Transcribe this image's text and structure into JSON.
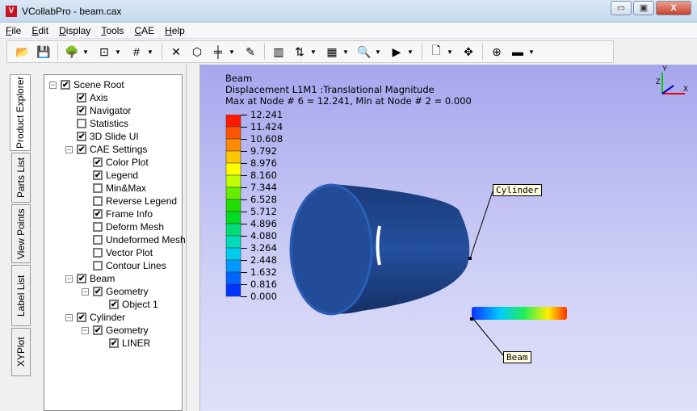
{
  "window": {
    "title": "VCollabPro - beam.cax",
    "minimize": "▭",
    "maximize": "▣",
    "close": "X"
  },
  "menu": [
    "File",
    "Edit",
    "Display",
    "Tools",
    "CAE",
    "Help"
  ],
  "toolbar": [
    {
      "name": "open-icon",
      "glyph": "📂"
    },
    {
      "name": "save-icon",
      "glyph": "💾"
    },
    {
      "sep": true
    },
    {
      "name": "background-icon",
      "glyph": "🌳",
      "dd": true
    },
    {
      "name": "fit-view-icon",
      "glyph": "⊡",
      "dd": true
    },
    {
      "name": "grid-icon",
      "glyph": "#",
      "dd": true
    },
    {
      "sep": true
    },
    {
      "name": "explode-icon",
      "glyph": "✕"
    },
    {
      "name": "box-icon",
      "glyph": "⬡"
    },
    {
      "name": "measure-icon",
      "glyph": "╪",
      "dd": true
    },
    {
      "name": "probe-icon",
      "glyph": "✎"
    },
    {
      "sep": true
    },
    {
      "name": "legend-icon",
      "glyph": "▥"
    },
    {
      "name": "contour-icon",
      "glyph": "⇅",
      "dd": true
    },
    {
      "name": "color-plot-icon",
      "glyph": "▦",
      "dd": true
    },
    {
      "name": "zoom-find-icon",
      "glyph": "🔍",
      "dd": true
    },
    {
      "name": "play-icon",
      "glyph": "▶",
      "dd": true
    },
    {
      "sep": true
    },
    {
      "name": "note-icon",
      "glyph": "🗋",
      "dd": true
    },
    {
      "name": "pan-icon",
      "glyph": "✥"
    },
    {
      "sep": true
    },
    {
      "name": "zoom-window-icon",
      "glyph": "⊕"
    },
    {
      "name": "split-view-icon",
      "glyph": "▬",
      "dd": true
    }
  ],
  "side_tabs": [
    "Product Explorer",
    "Parts List",
    "View Points",
    "Label List",
    "XYPlot"
  ],
  "tree": [
    {
      "label": "Scene Root",
      "level": 0,
      "checked": true,
      "exp": true
    },
    {
      "label": "Axis",
      "level": 1,
      "checked": true
    },
    {
      "label": "Navigator",
      "level": 1,
      "checked": true
    },
    {
      "label": "Statistics",
      "level": 1,
      "checked": false
    },
    {
      "label": "3D Slide UI",
      "level": 1,
      "checked": true
    },
    {
      "label": "CAE Settings",
      "level": 1,
      "checked": true,
      "exp": true
    },
    {
      "label": "Color Plot",
      "level": 2,
      "checked": true
    },
    {
      "label": "Legend",
      "level": 2,
      "checked": true
    },
    {
      "label": "Min&Max",
      "level": 2,
      "checked": false
    },
    {
      "label": "Reverse Legend",
      "level": 2,
      "checked": false
    },
    {
      "label": "Frame Info",
      "level": 2,
      "checked": true
    },
    {
      "label": "Deform Mesh",
      "level": 2,
      "checked": false
    },
    {
      "label": "Undeformed Mesh",
      "level": 2,
      "checked": false
    },
    {
      "label": "Vector Plot",
      "level": 2,
      "checked": false
    },
    {
      "label": "Contour Lines",
      "level": 2,
      "checked": false
    },
    {
      "label": "Beam",
      "level": 1,
      "checked": true,
      "exp": true
    },
    {
      "label": "Geometry",
      "level": 2,
      "checked": true,
      "exp": true
    },
    {
      "label": "Object 1",
      "level": 3,
      "checked": true
    },
    {
      "label": "Cylinder",
      "level": 1,
      "checked": true,
      "exp": true
    },
    {
      "label": "Geometry",
      "level": 2,
      "checked": true,
      "exp": true
    },
    {
      "label": "LINER",
      "level": 3,
      "checked": true
    }
  ],
  "viewport": {
    "info": [
      "Beam",
      "Displacement L1M1 :Translational Magnitude",
      "Max at Node # 6 = 12.241, Min at Node # 2 = 0.000"
    ],
    "legend": {
      "values": [
        "12.241",
        "11.424",
        "10.608",
        "9.792",
        "8.976",
        "8.160",
        "7.344",
        "6.528",
        "5.712",
        "4.896",
        "4.080",
        "3.264",
        "2.448",
        "1.632",
        "0.816",
        "0.000"
      ],
      "colors": [
        "#ff1a00",
        "#ff5500",
        "#ff8c00",
        "#ffc800",
        "#ffff00",
        "#bfff00",
        "#66ee00",
        "#22dd00",
        "#00dd22",
        "#00dd77",
        "#00ddbb",
        "#00ccee",
        "#0099ff",
        "#0066ff",
        "#0033ff"
      ]
    },
    "labels": {
      "cylinder": "Cylinder",
      "beam": "Beam"
    },
    "axis": {
      "x": "X",
      "y": "Y",
      "z": "Z"
    }
  }
}
